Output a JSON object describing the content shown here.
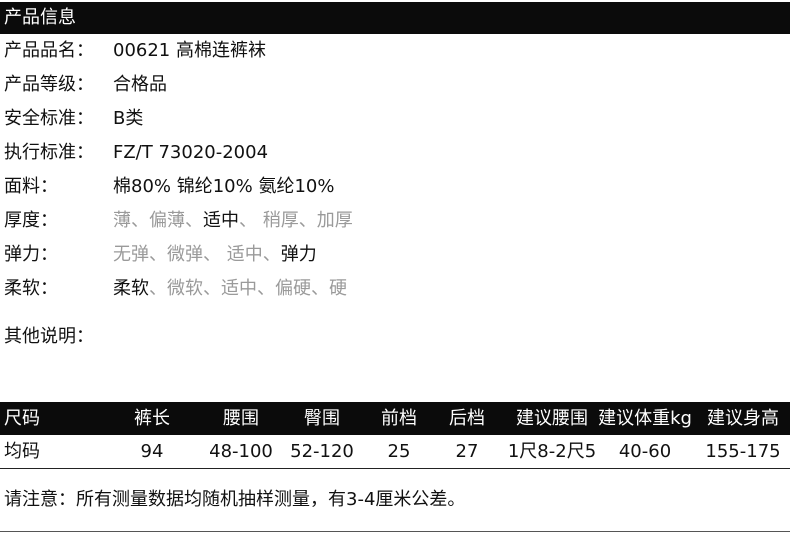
{
  "section_title": "产品信息",
  "info_rows": [
    {
      "label": "产品品名：",
      "value": "00621  高棉连裤袜"
    },
    {
      "label": "产品等级：",
      "value": "合格品"
    },
    {
      "label": "安全标准：",
      "value": "B类"
    },
    {
      "label": "执行标准：",
      "value": "FZ/T 73020-2004"
    },
    {
      "label": "面料：",
      "value": "棉80% 锦纶10% 氨纶10%"
    }
  ],
  "option_rows": [
    {
      "label": "厚度：",
      "options": [
        "薄",
        "偏薄",
        "适中",
        " 稍厚",
        "加厚"
      ],
      "selected": 2
    },
    {
      "label": "弹力：",
      "options": [
        "无弹",
        "微弹",
        " 适中",
        "弹力"
      ],
      "selected": 3
    },
    {
      "label": "柔软：",
      "options": [
        "柔软",
        "微软",
        "适中",
        "偏硬",
        "硬"
      ],
      "selected": 0
    }
  ],
  "other_label": "其他说明：",
  "size_table": {
    "headers": [
      "尺码",
      "裤长",
      "腰围",
      "臀围",
      "前档",
      "后档",
      "建议腰围",
      "建议体重kg",
      "建议身高"
    ],
    "rows": [
      [
        "均码",
        "94",
        "48-100",
        "52-120",
        "25",
        "27",
        "1尺8-2尺5",
        "40-60",
        "155-175"
      ]
    ]
  },
  "note": "请注意：所有测量数据均随机抽样测量，有3-4厘米公差。"
}
